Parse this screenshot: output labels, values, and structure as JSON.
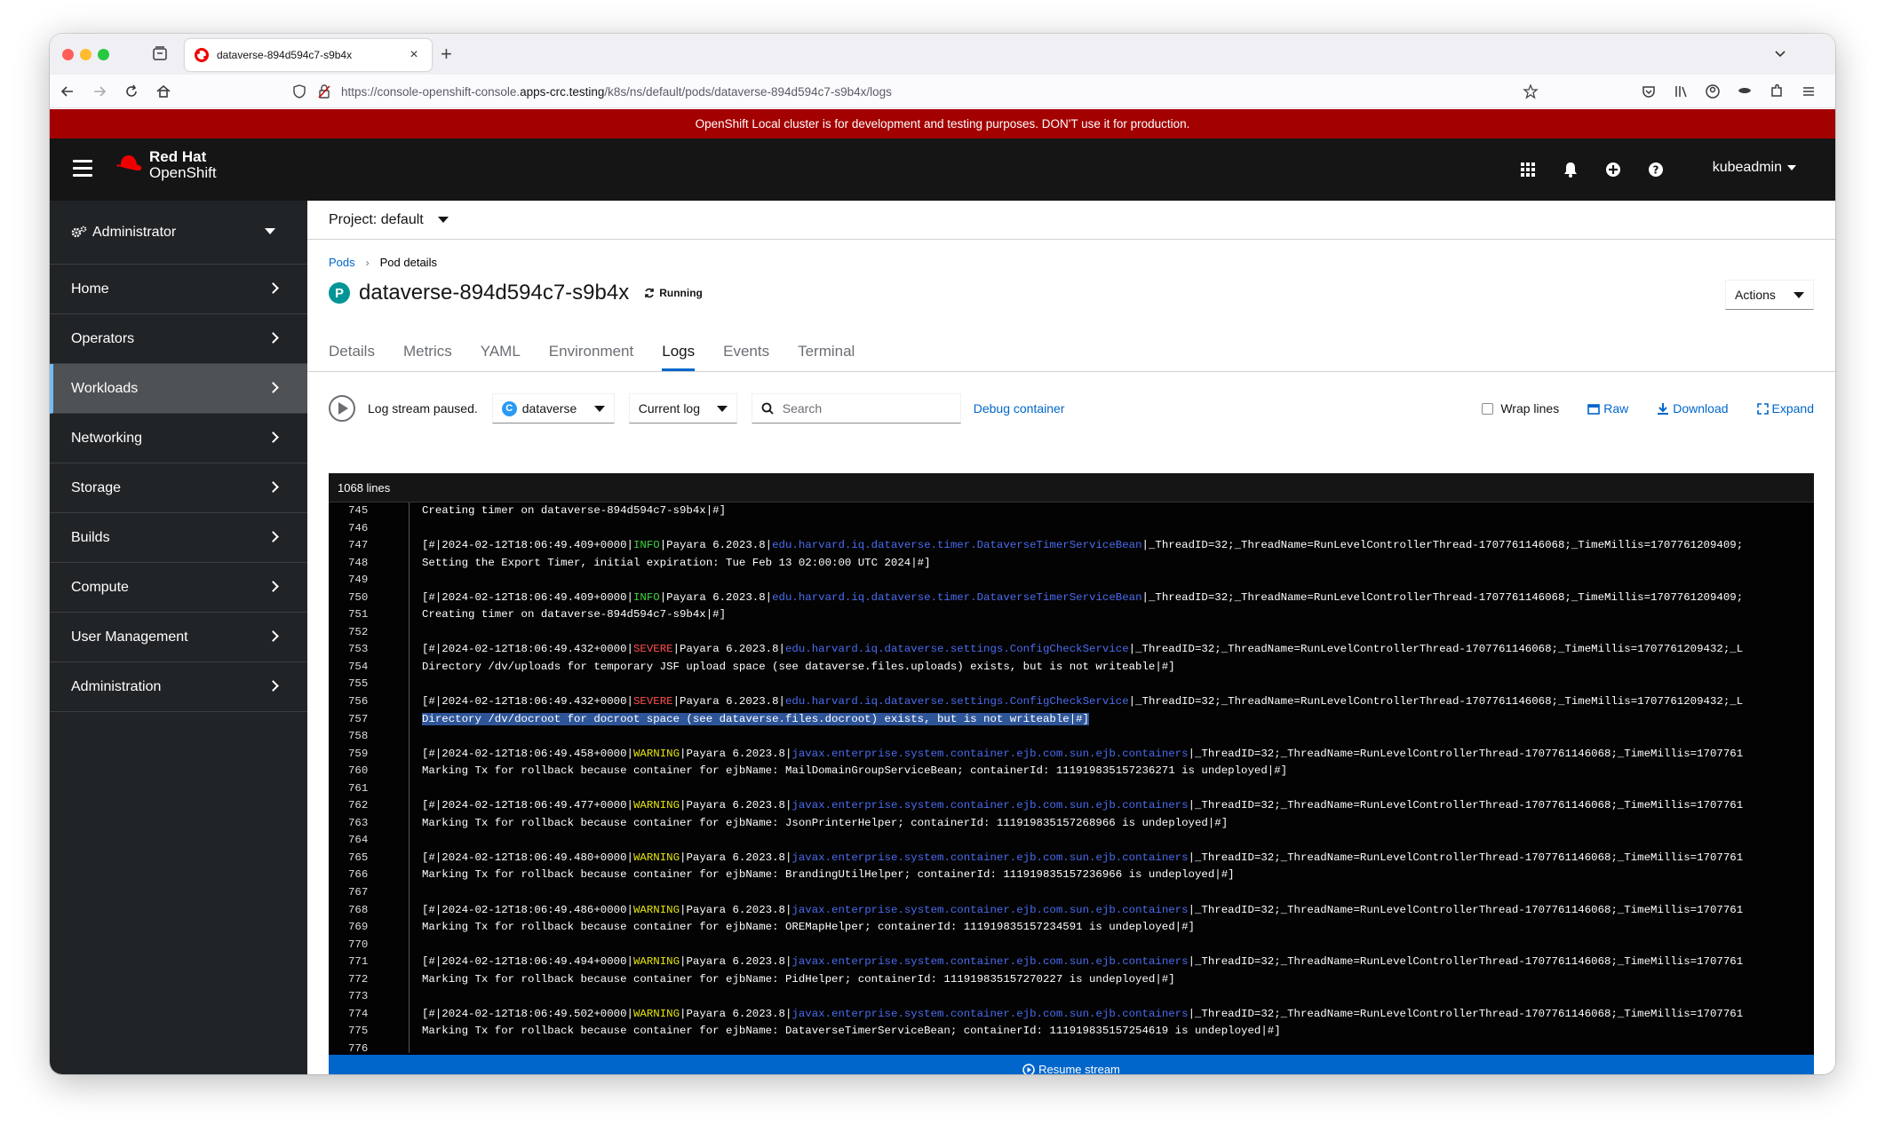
{
  "browser": {
    "tab_title": "dataverse-894d594c7-s9b4x",
    "url_prefix": "https://console-openshift-console.",
    "url_host": "apps-crc.testing",
    "url_path": "/k8s/ns/default/pods/dataverse-894d594c7-s9b4x/logs"
  },
  "banner": {
    "text": "OpenShift Local cluster is for development and testing purposes. DON'T use it for production."
  },
  "masthead": {
    "brand_line1": "Red Hat",
    "brand_line2": "OpenShift",
    "user": "kubeadmin"
  },
  "sidebar": {
    "perspective": "Administrator",
    "items": [
      {
        "label": "Home"
      },
      {
        "label": "Operators"
      },
      {
        "label": "Workloads"
      },
      {
        "label": "Networking"
      },
      {
        "label": "Storage"
      },
      {
        "label": "Builds"
      },
      {
        "label": "Compute"
      },
      {
        "label": "User Management"
      },
      {
        "label": "Administration"
      }
    ]
  },
  "project": {
    "label": "Project: default"
  },
  "breadcrumb": {
    "parent": "Pods",
    "current": "Pod details"
  },
  "pod": {
    "badge": "P",
    "name": "dataverse-894d594c7-s9b4x",
    "status": "Running"
  },
  "actions_label": "Actions",
  "tabs": [
    "Details",
    "Metrics",
    "YAML",
    "Environment",
    "Logs",
    "Events",
    "Terminal"
  ],
  "toolbar": {
    "stream_status": "Log stream paused.",
    "container_badge": "C",
    "container": "dataverse",
    "log_type": "Current log",
    "search_placeholder": "Search",
    "debug": "Debug container",
    "wrap": "Wrap lines",
    "raw": "Raw",
    "download": "Download",
    "expand": "Expand"
  },
  "log": {
    "line_count": "1068 lines",
    "resume": "Resume stream",
    "lines": [
      {
        "n": "745",
        "parts": [
          {
            "t": "Creating timer on dataverse-894d594c7-s9b4x|#]"
          }
        ]
      },
      {
        "n": "746",
        "parts": []
      },
      {
        "n": "747",
        "parts": [
          {
            "t": "[#|2024-02-12T18:06:49.409+0000|"
          },
          {
            "t": "INFO",
            "c": "info"
          },
          {
            "t": "|Payara 6.2023.8|"
          },
          {
            "t": "edu.harvard.iq.dataverse.timer.DataverseTimerServiceBean",
            "c": "pkg"
          },
          {
            "t": "|_ThreadID=32;_ThreadName=RunLevelControllerThread-1707761146068;_TimeMillis=1707761209409;"
          }
        ]
      },
      {
        "n": "748",
        "parts": [
          {
            "t": "Setting the Export Timer, initial expiration: Tue Feb 13 02:00:00 UTC 2024|#]"
          }
        ]
      },
      {
        "n": "749",
        "parts": []
      },
      {
        "n": "750",
        "parts": [
          {
            "t": "[#|2024-02-12T18:06:49.409+0000|"
          },
          {
            "t": "INFO",
            "c": "info"
          },
          {
            "t": "|Payara 6.2023.8|"
          },
          {
            "t": "edu.harvard.iq.dataverse.timer.DataverseTimerServiceBean",
            "c": "pkg"
          },
          {
            "t": "|_ThreadID=32;_ThreadName=RunLevelControllerThread-1707761146068;_TimeMillis=1707761209409;"
          }
        ]
      },
      {
        "n": "751",
        "parts": [
          {
            "t": "Creating timer on dataverse-894d594c7-s9b4x|#]"
          }
        ]
      },
      {
        "n": "752",
        "parts": []
      },
      {
        "n": "753",
        "parts": [
          {
            "t": "[#|2024-02-12T18:06:49.432+0000|"
          },
          {
            "t": "SEVERE",
            "c": "severe"
          },
          {
            "t": "|Payara 6.2023.8|"
          },
          {
            "t": "edu.harvard.iq.dataverse.settings.ConfigCheckService",
            "c": "pkg"
          },
          {
            "t": "|_ThreadID=32;_ThreadName=RunLevelControllerThread-1707761146068;_TimeMillis=1707761209432;_L"
          }
        ]
      },
      {
        "n": "754",
        "parts": [
          {
            "t": "Directory /dv/uploads for temporary JSF upload space (see dataverse.files.uploads) exists, but is not writeable|#]"
          }
        ]
      },
      {
        "n": "755",
        "parts": []
      },
      {
        "n": "756",
        "parts": [
          {
            "t": "[#|2024-02-12T18:06:49.432+0000|"
          },
          {
            "t": "SEVERE",
            "c": "severe"
          },
          {
            "t": "|Payara 6.2023.8|"
          },
          {
            "t": "edu.harvard.iq.dataverse.settings.ConfigCheckService",
            "c": "pkg"
          },
          {
            "t": "|_ThreadID=32;_ThreadName=RunLevelControllerThread-1707761146068;_TimeMillis=1707761209432;_L"
          }
        ]
      },
      {
        "n": "757",
        "parts": [
          {
            "t": "Directory /dv/docroot for docroot space (see dataverse.files.docroot) exists, but is not writeable|#]",
            "c": "sel"
          }
        ]
      },
      {
        "n": "758",
        "parts": []
      },
      {
        "n": "759",
        "parts": [
          {
            "t": "[#|2024-02-12T18:06:49.458+0000|"
          },
          {
            "t": "WARNING",
            "c": "warning"
          },
          {
            "t": "|Payara 6.2023.8|"
          },
          {
            "t": "javax.enterprise.system.container.ejb.com.sun.ejb.containers",
            "c": "pkg"
          },
          {
            "t": "|_ThreadID=32;_ThreadName=RunLevelControllerThread-1707761146068;_TimeMillis=1707761"
          }
        ]
      },
      {
        "n": "760",
        "parts": [
          {
            "t": "Marking Tx for rollback because container for ejbName: MailDomainGroupServiceBean; containerId: 111919835157236271 is undeployed|#]"
          }
        ]
      },
      {
        "n": "761",
        "parts": []
      },
      {
        "n": "762",
        "parts": [
          {
            "t": "[#|2024-02-12T18:06:49.477+0000|"
          },
          {
            "t": "WARNING",
            "c": "warning"
          },
          {
            "t": "|Payara 6.2023.8|"
          },
          {
            "t": "javax.enterprise.system.container.ejb.com.sun.ejb.containers",
            "c": "pkg"
          },
          {
            "t": "|_ThreadID=32;_ThreadName=RunLevelControllerThread-1707761146068;_TimeMillis=1707761"
          }
        ]
      },
      {
        "n": "763",
        "parts": [
          {
            "t": "Marking Tx for rollback because container for ejbName: JsonPrinterHelper; containerId: 111919835157268966 is undeployed|#]"
          }
        ]
      },
      {
        "n": "764",
        "parts": []
      },
      {
        "n": "765",
        "parts": [
          {
            "t": "[#|2024-02-12T18:06:49.480+0000|"
          },
          {
            "t": "WARNING",
            "c": "warning"
          },
          {
            "t": "|Payara 6.2023.8|"
          },
          {
            "t": "javax.enterprise.system.container.ejb.com.sun.ejb.containers",
            "c": "pkg"
          },
          {
            "t": "|_ThreadID=32;_ThreadName=RunLevelControllerThread-1707761146068;_TimeMillis=1707761"
          }
        ]
      },
      {
        "n": "766",
        "parts": [
          {
            "t": "Marking Tx for rollback because container for ejbName: BrandingUtilHelper; containerId: 111919835157236966 is undeployed|#]"
          }
        ]
      },
      {
        "n": "767",
        "parts": []
      },
      {
        "n": "768",
        "parts": [
          {
            "t": "[#|2024-02-12T18:06:49.486+0000|"
          },
          {
            "t": "WARNING",
            "c": "warning"
          },
          {
            "t": "|Payara 6.2023.8|"
          },
          {
            "t": "javax.enterprise.system.container.ejb.com.sun.ejb.containers",
            "c": "pkg"
          },
          {
            "t": "|_ThreadID=32;_ThreadName=RunLevelControllerThread-1707761146068;_TimeMillis=1707761"
          }
        ]
      },
      {
        "n": "769",
        "parts": [
          {
            "t": "Marking Tx for rollback because container for ejbName: OREMapHelper; containerId: 111919835157234591 is undeployed|#]"
          }
        ]
      },
      {
        "n": "770",
        "parts": []
      },
      {
        "n": "771",
        "parts": [
          {
            "t": "[#|2024-02-12T18:06:49.494+0000|"
          },
          {
            "t": "WARNING",
            "c": "warning"
          },
          {
            "t": "|Payara 6.2023.8|"
          },
          {
            "t": "javax.enterprise.system.container.ejb.com.sun.ejb.containers",
            "c": "pkg"
          },
          {
            "t": "|_ThreadID=32;_ThreadName=RunLevelControllerThread-1707761146068;_TimeMillis=1707761"
          }
        ]
      },
      {
        "n": "772",
        "parts": [
          {
            "t": "Marking Tx for rollback because container for ejbName: PidHelper; containerId: 111919835157270227 is undeployed|#]"
          }
        ]
      },
      {
        "n": "773",
        "parts": []
      },
      {
        "n": "774",
        "parts": [
          {
            "t": "[#|2024-02-12T18:06:49.502+0000|"
          },
          {
            "t": "WARNING",
            "c": "warning"
          },
          {
            "t": "|Payara 6.2023.8|"
          },
          {
            "t": "javax.enterprise.system.container.ejb.com.sun.ejb.containers",
            "c": "pkg"
          },
          {
            "t": "|_ThreadID=32;_ThreadName=RunLevelControllerThread-1707761146068;_TimeMillis=1707761"
          }
        ]
      },
      {
        "n": "775",
        "parts": [
          {
            "t": "Marking Tx for rollback because container for ejbName: DataverseTimerServiceBean; containerId: 111919835157254619 is undeployed|#]"
          }
        ]
      },
      {
        "n": "776",
        "parts": []
      }
    ]
  }
}
